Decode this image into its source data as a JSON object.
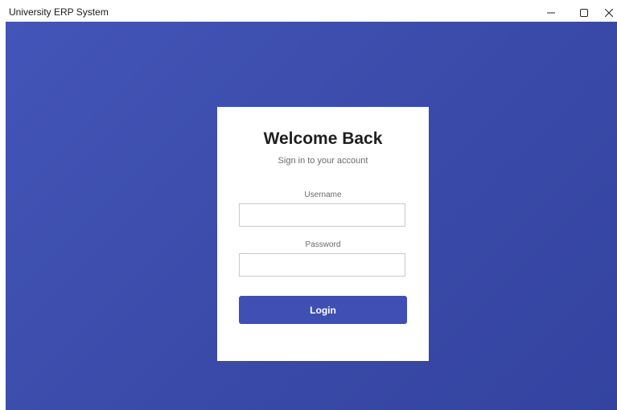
{
  "window": {
    "title": "University ERP System"
  },
  "icons": {
    "minimize": "minimize-icon",
    "maximize": "maximize-icon",
    "close": "close-icon"
  },
  "colors": {
    "background_start": "#4355b8",
    "background_end": "#3443a0",
    "card": "#ffffff",
    "button": "#3f4fb3",
    "button_text": "#ffffff",
    "title_text": "#1f1f1f",
    "muted_text": "#6b6b6b"
  },
  "login": {
    "heading": "Welcome Back",
    "subheading": "Sign in to your account",
    "username_label": "Username",
    "username_value": "",
    "password_label": "Password",
    "password_value": "",
    "submit_label": "Login"
  }
}
